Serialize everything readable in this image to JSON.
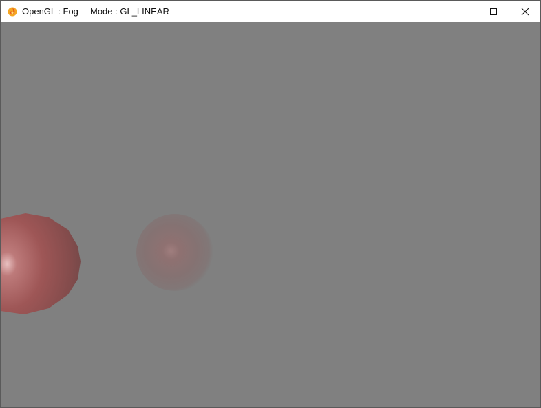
{
  "window": {
    "title": "OpenGL : Fog",
    "mode_text": "Mode : GL_LINEAR",
    "icon": "flame-app-icon",
    "controls": {
      "minimize_icon": "minimize-icon",
      "maximize_icon": "maximize-icon",
      "close_icon": "close-icon"
    }
  },
  "scene": {
    "fog_color": "#808080",
    "sphere_color": "#9c4a4a",
    "spheres": [
      {
        "name": "near-sphere",
        "appearance": "red, lit, partially fogged"
      },
      {
        "name": "far-sphere",
        "appearance": "heavily fogged"
      }
    ]
  }
}
